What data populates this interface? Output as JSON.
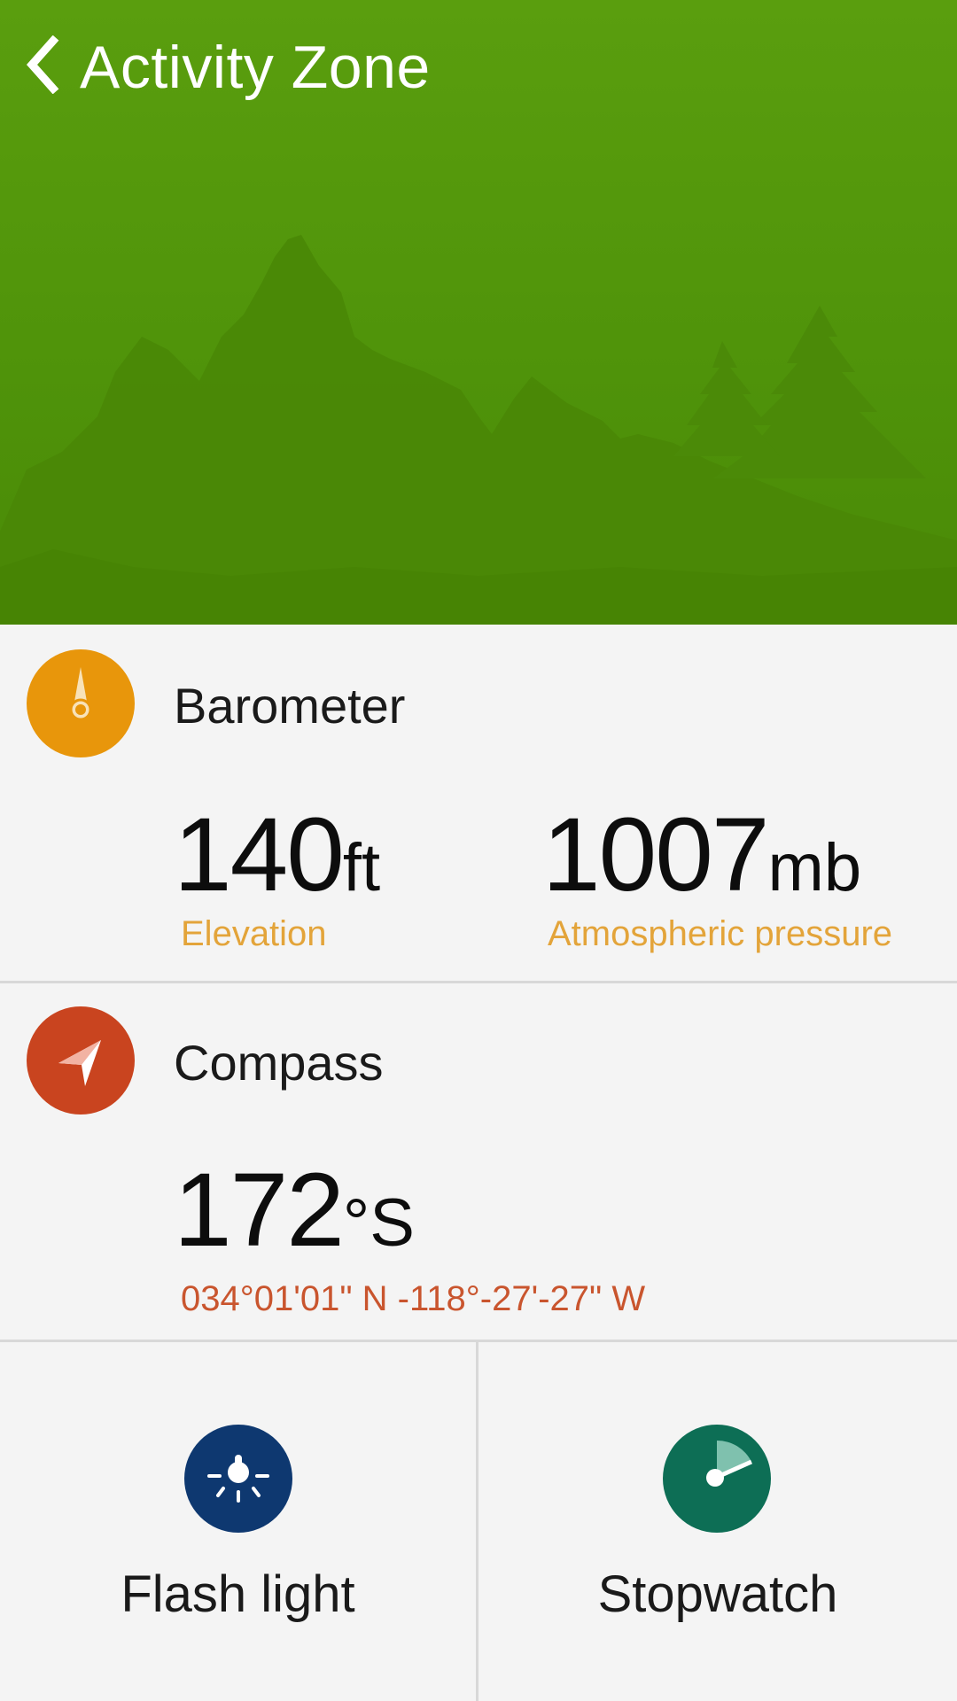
{
  "header": {
    "title": "Activity Zone",
    "back_icon": "chevron-left-icon",
    "background_color": "#529a0c"
  },
  "barometer": {
    "title": "Barometer",
    "icon": "barometer-needle-icon",
    "accent": "#e8960b",
    "elevation": {
      "value": "140",
      "unit": "ft",
      "label": "Elevation"
    },
    "pressure": {
      "value": "1007",
      "unit": "mb",
      "label": "Atmospheric pressure"
    }
  },
  "compass": {
    "title": "Compass",
    "icon": "compass-arrow-icon",
    "accent": "#c9441f",
    "heading": {
      "value": "172",
      "unit": "°S"
    },
    "coordinates": "034°01'01\" N -118°-27'-27\" W"
  },
  "tools": [
    {
      "label": "Flash light",
      "icon": "flashlight-icon",
      "color": "#0e3870"
    },
    {
      "label": "Stopwatch",
      "icon": "stopwatch-icon",
      "color": "#0d6e55"
    }
  ]
}
